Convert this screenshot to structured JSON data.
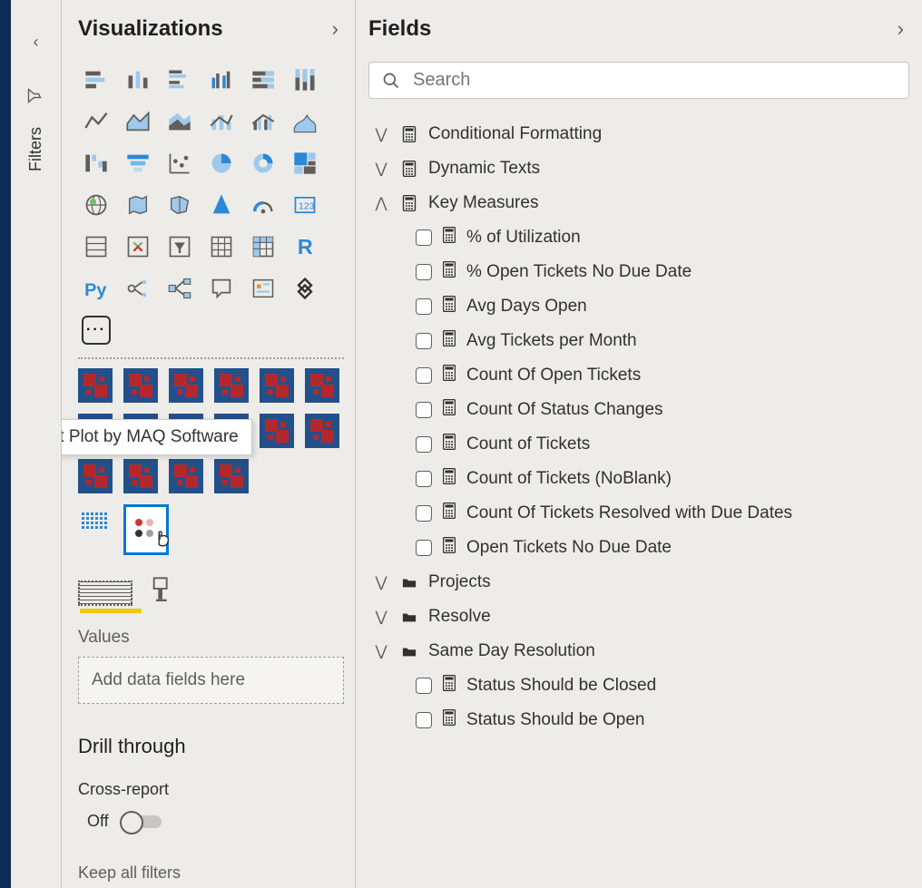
{
  "filters": {
    "label": "Filters"
  },
  "visualizations": {
    "title": "Visualizations",
    "tooltip": "Dot Plot by MAQ Software",
    "values_label": "Values",
    "drop_placeholder": "Add data fields here",
    "drill_title": "Drill through",
    "cross_report_label": "Cross-report",
    "toggle_off": "Off",
    "keep_filters": "Keep all filters"
  },
  "fields": {
    "title": "Fields",
    "search_placeholder": "Search",
    "tables": [
      {
        "name": "Conditional Formatting",
        "type": "calc",
        "expanded": false,
        "children": []
      },
      {
        "name": "Dynamic Texts",
        "type": "calc",
        "expanded": false,
        "children": []
      },
      {
        "name": "Key Measures",
        "type": "calc",
        "expanded": true,
        "children": [
          "% of Utilization",
          "% Open Tickets No Due Date",
          "Avg Days Open",
          "Avg Tickets per Month",
          "Count Of Open Tickets",
          "Count Of Status Changes",
          "Count of Tickets",
          "Count of Tickets (NoBlank)",
          "Count Of Tickets Resolved with Due Dates",
          "Open Tickets No Due Date"
        ]
      },
      {
        "name": "Projects",
        "type": "folder",
        "expanded": false,
        "children": []
      },
      {
        "name": "Resolve",
        "type": "folder",
        "expanded": false,
        "children": []
      },
      {
        "name": "Same Day Resolution",
        "type": "folder",
        "expanded": false,
        "children": [
          "Status Should be Closed",
          "Status Should be Open"
        ]
      }
    ]
  }
}
